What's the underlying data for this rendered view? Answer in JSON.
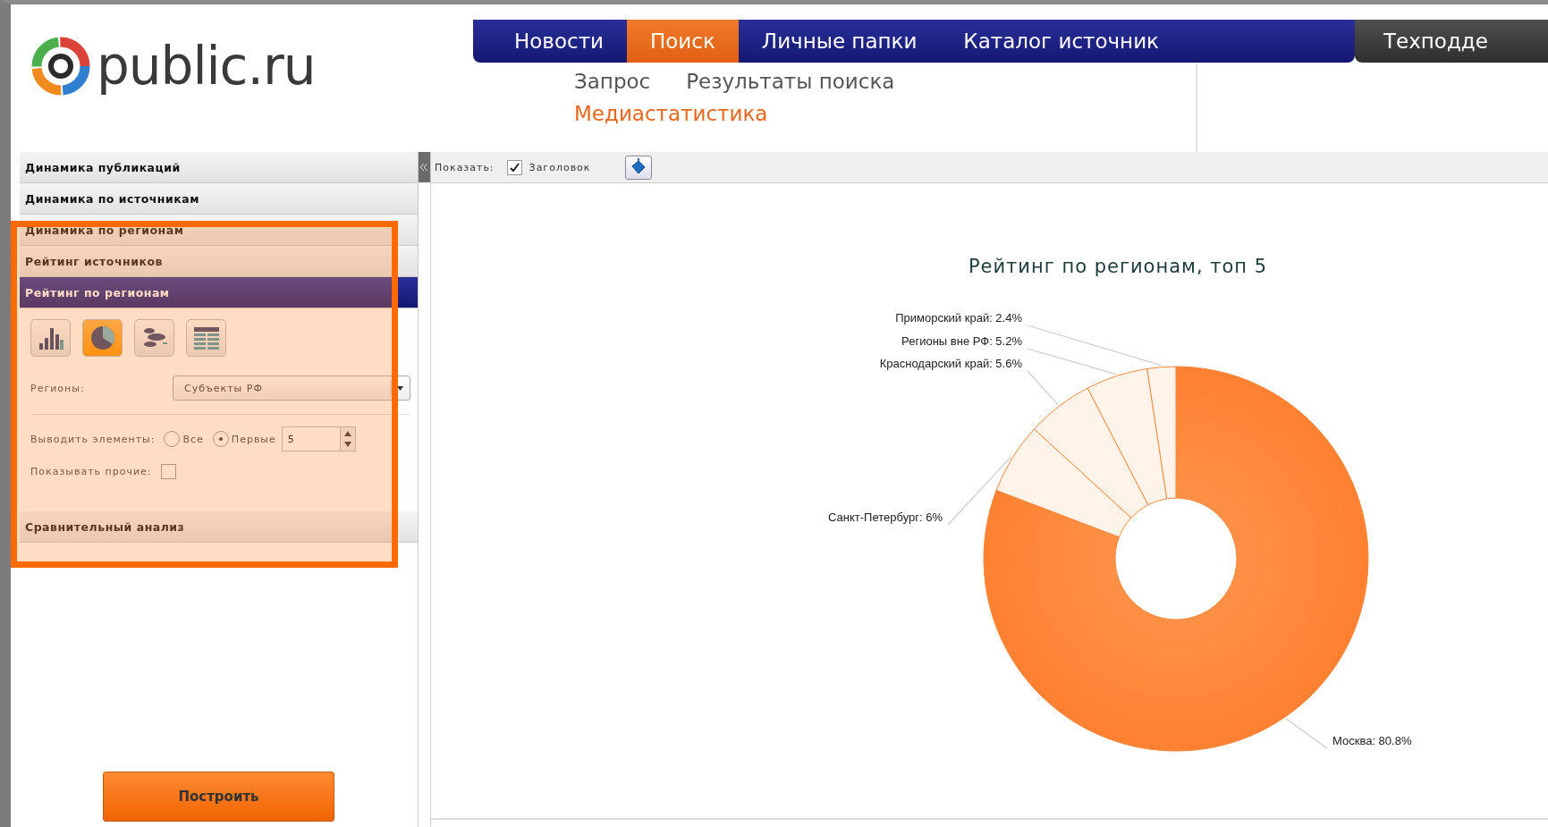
{
  "logo": {
    "text": "public.ru"
  },
  "nav": {
    "items": [
      {
        "label": "Новости",
        "selected": false
      },
      {
        "label": "Поиск",
        "selected": true
      },
      {
        "label": "Личные папки",
        "selected": false
      },
      {
        "label": "Каталог источник",
        "selected": false
      }
    ],
    "extra_tab": "Техподде"
  },
  "subnav": [
    {
      "label": "Запрос",
      "selected": false
    },
    {
      "label": "Результаты поиска",
      "selected": false
    },
    {
      "label": "Медиастатистика",
      "selected": true
    }
  ],
  "sidebar": {
    "sections": [
      {
        "label": "Динамика публикаций",
        "selected": false
      },
      {
        "label": "Динамика по источникам",
        "selected": false
      },
      {
        "label": "Динамика по регионам",
        "selected": false
      },
      {
        "label": "Рейтинг источников",
        "selected": false
      },
      {
        "label": "Рейтинг по регионам",
        "selected": true
      },
      {
        "label": "Сравнительный анализ",
        "selected": false
      }
    ],
    "chart_types": [
      {
        "kind": "bar",
        "selected": false
      },
      {
        "kind": "pie",
        "selected": true
      },
      {
        "kind": "bubble",
        "selected": false
      },
      {
        "kind": "table",
        "selected": false
      }
    ],
    "regions": {
      "label": "Регионы:",
      "value": "Субъекты РФ"
    },
    "output": {
      "label": "Выводить элементы:",
      "options": [
        {
          "label": "Все",
          "selected": false
        },
        {
          "label": "Первые",
          "selected": true
        }
      ],
      "count": "5"
    },
    "show_other": {
      "label": "Показывать прочие:",
      "checked": false
    },
    "build_button": "Построить"
  },
  "toolbar": {
    "label": "Показать:",
    "title_checkbox": {
      "label": "Заголовок",
      "checked": true
    }
  },
  "chart_data": {
    "type": "donut",
    "title": "Рейтинг по регионам, топ 5",
    "values": [
      80.8,
      6,
      5.6,
      5.2,
      2.4
    ],
    "value_labels": [
      "Москва: 80.8%",
      "Санкт-Петербург: 6%",
      "Краснодарский край: 5.6%",
      "Регионы вне РФ: 5.2%",
      "Приморский край: 2.4%"
    ]
  }
}
